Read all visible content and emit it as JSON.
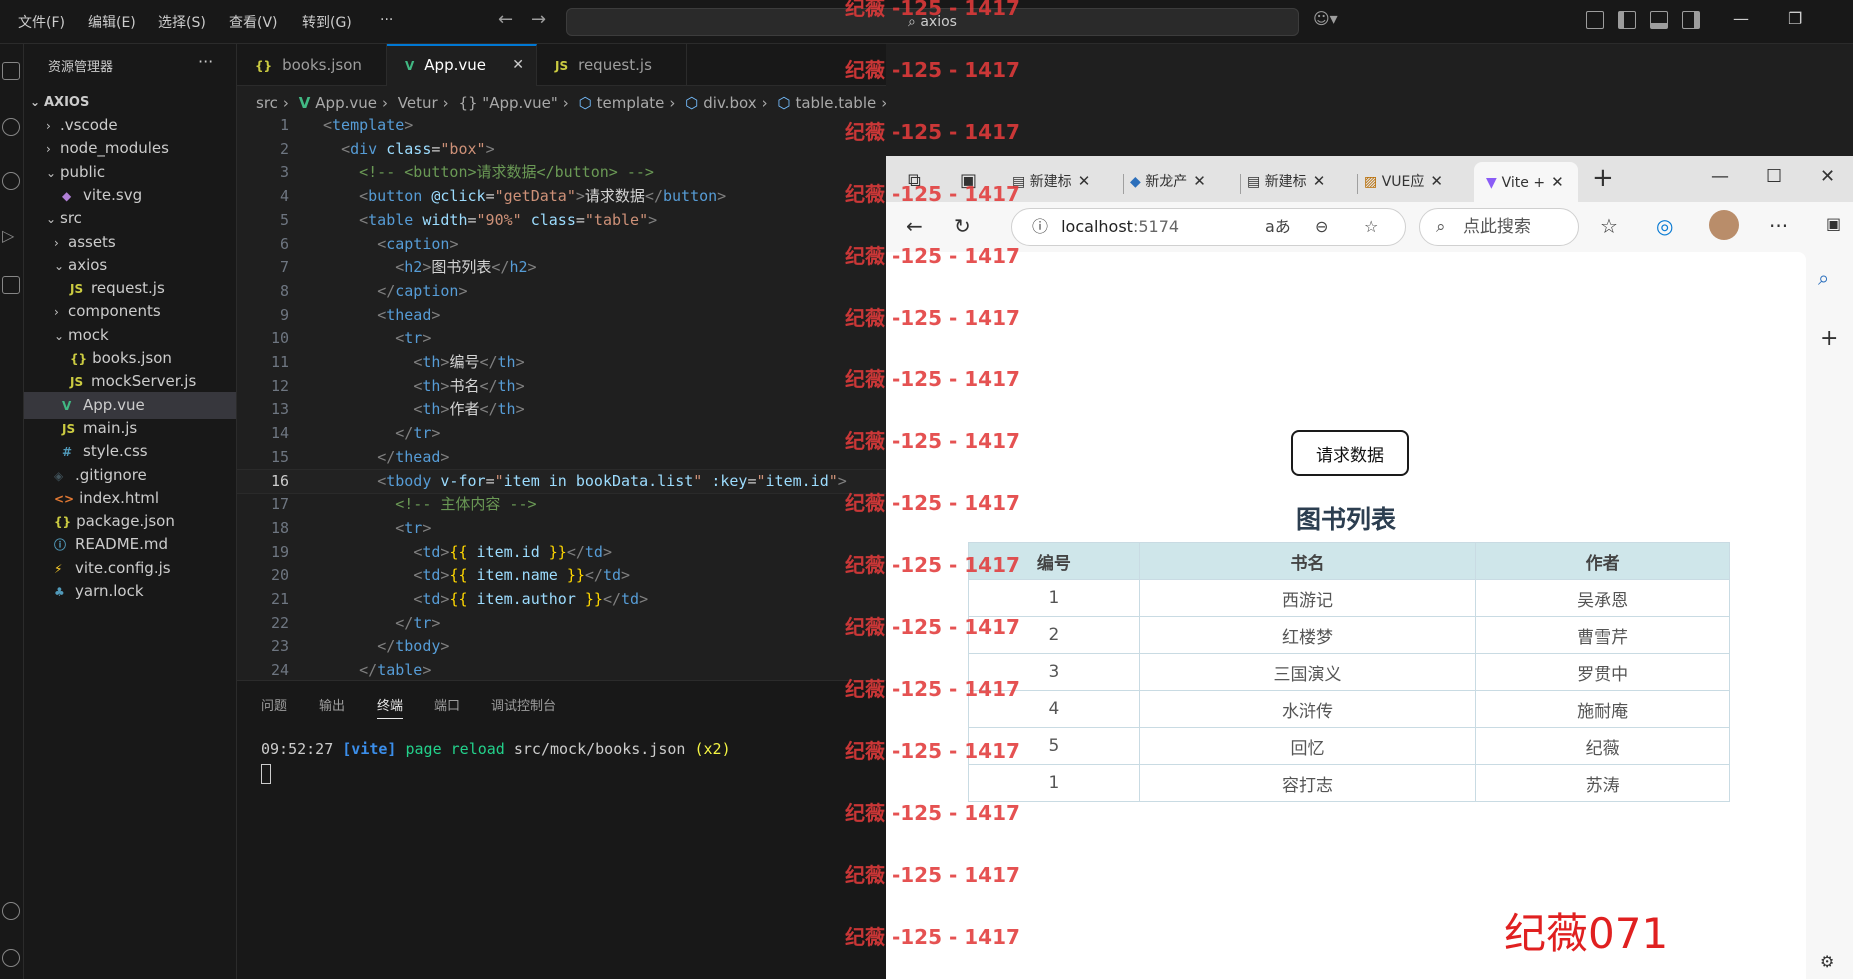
{
  "vscode": {
    "menu": [
      "文件(F)",
      "编辑(E)",
      "选择(S)",
      "查看(V)",
      "转到(G)",
      "···"
    ],
    "command_center": "axios",
    "explorer": {
      "title": "资源管理器",
      "more": "···",
      "root": "AXIOS",
      "items": [
        {
          "label": ".vscode",
          "kind": "folder",
          "expanded": false,
          "depth": 1
        },
        {
          "label": "node_modules",
          "kind": "folder",
          "expanded": false,
          "depth": 1
        },
        {
          "label": "public",
          "kind": "folder",
          "expanded": true,
          "depth": 1
        },
        {
          "label": "vite.svg",
          "kind": "svg",
          "depth": 2
        },
        {
          "label": "src",
          "kind": "folder",
          "expanded": true,
          "depth": 1
        },
        {
          "label": "assets",
          "kind": "folder",
          "expanded": false,
          "depth": 2
        },
        {
          "label": "axios",
          "kind": "folder",
          "expanded": true,
          "depth": 2
        },
        {
          "label": "request.js",
          "kind": "js",
          "depth": 3
        },
        {
          "label": "components",
          "kind": "folder",
          "expanded": false,
          "depth": 2
        },
        {
          "label": "mock",
          "kind": "folder",
          "expanded": true,
          "depth": 2
        },
        {
          "label": "books.json",
          "kind": "json",
          "depth": 3
        },
        {
          "label": "mockServer.js",
          "kind": "js",
          "depth": 3
        },
        {
          "label": "App.vue",
          "kind": "vue",
          "depth": 2,
          "selected": true
        },
        {
          "label": "main.js",
          "kind": "js",
          "depth": 2
        },
        {
          "label": "style.css",
          "kind": "css",
          "depth": 2
        },
        {
          "label": ".gitignore",
          "kind": "git",
          "depth": 1
        },
        {
          "label": "index.html",
          "kind": "html",
          "depth": 1
        },
        {
          "label": "package.json",
          "kind": "json",
          "depth": 1
        },
        {
          "label": "README.md",
          "kind": "info",
          "depth": 1
        },
        {
          "label": "vite.config.js",
          "kind": "vite",
          "depth": 1
        },
        {
          "label": "yarn.lock",
          "kind": "yarn",
          "depth": 1
        }
      ]
    },
    "tabs": [
      {
        "label": "books.json",
        "icon": "{}"
      },
      {
        "label": "App.vue",
        "icon": "V",
        "close": "✕"
      },
      {
        "label": "request.js",
        "icon": "JS"
      }
    ],
    "breadcrumb": [
      "src",
      "App.vue",
      "Vetur",
      "{} \"App.vue\"",
      "template",
      "div.box",
      "table.table",
      "tbody"
    ],
    "code_lines": [
      {
        "n": "1",
        "html": "<span class='br'>&lt;</span><span class='tg'>template</span><span class='br'>&gt;</span>"
      },
      {
        "n": "2",
        "html": "  <span class='br'>&lt;</span><span class='tg'>div</span> <span class='at'>class</span>=<span class='sv'>\"box\"</span><span class='br'>&gt;</span>"
      },
      {
        "n": "3",
        "html": "    <span class='cm'>&lt;!-- &lt;button&gt;请求数据&lt;/button&gt; --&gt;</span>"
      },
      {
        "n": "4",
        "html": "    <span class='br'>&lt;</span><span class='tg'>button</span> <span class='at'>@click</span>=<span class='sv'>\"getData\"</span><span class='br'>&gt;</span><span class='tx'>请求数据</span><span class='br'>&lt;/</span><span class='tg'>button</span><span class='br'>&gt;</span>"
      },
      {
        "n": "5",
        "html": "    <span class='br'>&lt;</span><span class='tg'>table</span> <span class='at'>width</span>=<span class='sv'>\"90%\"</span> <span class='at'>class</span>=<span class='sv'>\"table\"</span><span class='br'>&gt;</span>"
      },
      {
        "n": "6",
        "html": "      <span class='br'>&lt;</span><span class='tg'>caption</span><span class='br'>&gt;</span>"
      },
      {
        "n": "7",
        "html": "        <span class='br'>&lt;</span><span class='tg'>h2</span><span class='br'>&gt;</span><span class='tx'>图书列表</span><span class='br'>&lt;/</span><span class='tg'>h2</span><span class='br'>&gt;</span>"
      },
      {
        "n": "8",
        "html": "      <span class='br'>&lt;/</span><span class='tg'>caption</span><span class='br'>&gt;</span>"
      },
      {
        "n": "9",
        "html": "      <span class='br'>&lt;</span><span class='tg'>thead</span><span class='br'>&gt;</span>"
      },
      {
        "n": "10",
        "html": "        <span class='br'>&lt;</span><span class='tg'>tr</span><span class='br'>&gt;</span>"
      },
      {
        "n": "11",
        "html": "          <span class='br'>&lt;</span><span class='tg'>th</span><span class='br'>&gt;</span><span class='tx'>编号</span><span class='br'>&lt;/</span><span class='tg'>th</span><span class='br'>&gt;</span>"
      },
      {
        "n": "12",
        "html": "          <span class='br'>&lt;</span><span class='tg'>th</span><span class='br'>&gt;</span><span class='tx'>书名</span><span class='br'>&lt;/</span><span class='tg'>th</span><span class='br'>&gt;</span>"
      },
      {
        "n": "13",
        "html": "          <span class='br'>&lt;</span><span class='tg'>th</span><span class='br'>&gt;</span><span class='tx'>作者</span><span class='br'>&lt;/</span><span class='tg'>th</span><span class='br'>&gt;</span>"
      },
      {
        "n": "14",
        "html": "        <span class='br'>&lt;/</span><span class='tg'>tr</span><span class='br'>&gt;</span>"
      },
      {
        "n": "15",
        "html": "      <span class='br'>&lt;/</span><span class='tg'>thead</span><span class='br'>&gt;</span>"
      },
      {
        "n": "16",
        "html": "      <span class='br'>&lt;</span><span class='tg'>tbody</span> <span class='at'>v-for</span>=<span class='sv'>\"</span><span class='ex'>item in bookData.list</span><span class='sv'>\"</span> <span class='at'>:key</span>=<span class='sv'>\"</span><span class='ex'>item.id</span><span class='sv'>\"</span><span class='br'>&gt;</span>",
        "current": true
      },
      {
        "n": "17",
        "html": "        <span class='cm'>&lt;!-- 主体内容 --&gt;</span>"
      },
      {
        "n": "18",
        "html": "        <span class='br'>&lt;</span><span class='tg'>tr</span><span class='br'>&gt;</span>"
      },
      {
        "n": "19",
        "html": "          <span class='br'>&lt;</span><span class='tg'>td</span><span class='br'>&gt;</span><span class='mu'>{{</span> <span class='ex'>item.id</span> <span class='mu'>}}</span><span class='br'>&lt;/</span><span class='tg'>td</span><span class='br'>&gt;</span>"
      },
      {
        "n": "20",
        "html": "          <span class='br'>&lt;</span><span class='tg'>td</span><span class='br'>&gt;</span><span class='mu'>{{</span> <span class='ex'>item.name</span> <span class='mu'>}}</span><span class='br'>&lt;/</span><span class='tg'>td</span><span class='br'>&gt;</span>"
      },
      {
        "n": "21",
        "html": "          <span class='br'>&lt;</span><span class='tg'>td</span><span class='br'>&gt;</span><span class='mu'>{{</span> <span class='ex'>item.author</span> <span class='mu'>}}</span><span class='br'>&lt;/</span><span class='tg'>td</span><span class='br'>&gt;</span>"
      },
      {
        "n": "22",
        "html": "        <span class='br'>&lt;/</span><span class='tg'>tr</span><span class='br'>&gt;</span>"
      },
      {
        "n": "23",
        "html": "      <span class='br'>&lt;/</span><span class='tg'>tbody</span><span class='br'>&gt;</span>"
      },
      {
        "n": "24",
        "html": "    <span class='br'>&lt;/</span><span class='tg'>table</span><span class='br'>&gt;</span>"
      }
    ],
    "panel_tabs": [
      "问题",
      "输出",
      "终端",
      "端口",
      "调试控制台"
    ],
    "terminal": {
      "time": "09:52:27",
      "tag": "[vite]",
      "msg": "page reload",
      "path": "src/mock/books.json",
      "count": "(x2)"
    }
  },
  "browser": {
    "tabs": [
      "新建标",
      "新龙产",
      "新建标",
      "VUE应",
      "Vite +"
    ],
    "address": "localhost",
    "port": ":5174",
    "search_placeholder": "点此搜索",
    "page": {
      "button_label": "请求数据",
      "title": "图书列表",
      "table": {
        "headers": [
          "编号",
          "书名",
          "作者"
        ],
        "rows": [
          [
            "1",
            "西游记",
            "吴承恩"
          ],
          [
            "2",
            "红楼梦",
            "曹雪芹"
          ],
          [
            "3",
            "三国演义",
            "罗贯中"
          ],
          [
            "4",
            "水浒传",
            "施耐庵"
          ],
          [
            "5",
            "回忆",
            "纪薇"
          ],
          [
            "1",
            "容打志",
            "苏涛"
          ]
        ]
      }
    }
  },
  "watermark": {
    "text": "纪薇 -125 - 1417",
    "signature": "纪薇071"
  },
  "colors": {
    "vscode_bg": "#1f1f1f",
    "accent": "#0078d4",
    "table_header": "#cfe6ea",
    "watermark": "#e23b3b"
  }
}
